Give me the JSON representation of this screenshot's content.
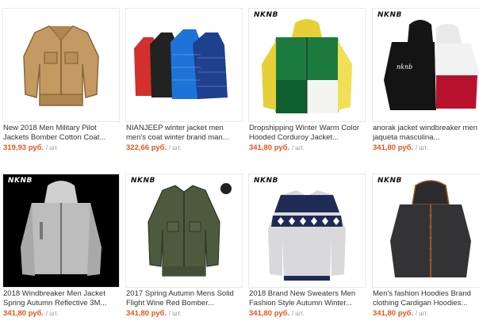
{
  "products": [
    {
      "title_line1": "New 2018 Men Military Pilot",
      "title_line2": "Jackets Bomber Cotton Coat...",
      "price": "319,93 руб.",
      "unit": "/ шт.",
      "brand": ""
    },
    {
      "title_line1": "NIANJEEP winter jacket men",
      "title_line2": "men's coat winter brand man...",
      "price": "322,66 руб.",
      "unit": "/ шт.",
      "brand": ""
    },
    {
      "title_line1": "Dropshipping Winter Warm Color",
      "title_line2": "Hooded Corduroy Jacket...",
      "price": "341,80 руб.",
      "unit": "/ шт.",
      "brand": "NKNB"
    },
    {
      "title_line1": "anorak jacket windbreaker men",
      "title_line2": "jaqueta masculina...",
      "price": "341,80 руб.",
      "unit": "/ шт.",
      "brand": "NKNB"
    },
    {
      "title_line1": "2018 Windbreaker Men Jacket",
      "title_line2": "Spring Autumn Reflective 3M...",
      "price": "341,80 руб.",
      "unit": "/ шт.",
      "brand": "NKNB"
    },
    {
      "title_line1": "2017 Spring Autumn Mens Solid",
      "title_line2": "Flight Wine Red Bomber...",
      "price": "341,80 руб.",
      "unit": "/ шт.",
      "brand": "NKNB"
    },
    {
      "title_line1": "2018 Brand New Sweaters Men",
      "title_line2": "Fashion Style Autumn Winter...",
      "price": "341,80 руб.",
      "unit": "/ шт.",
      "brand": "NKNB"
    },
    {
      "title_line1": "Men's fashion Hoodies Brand",
      "title_line2": "clothing Cardigan Hoodies...",
      "price": "341,80 руб.",
      "unit": "/ шт.",
      "brand": "NKNB"
    }
  ],
  "colors": {
    "price": "#e7541e",
    "unit": "#999999",
    "title": "#333333"
  },
  "icons": [
    "tan-military-jacket-image",
    "puffer-jackets-image",
    "colorblock-hoodie-image",
    "anorak-windbreaker-image",
    "reflective-windbreaker-image",
    "green-bomber-jacket-image",
    "patterned-sweater-image",
    "dark-hoodie-cardigan-image"
  ]
}
